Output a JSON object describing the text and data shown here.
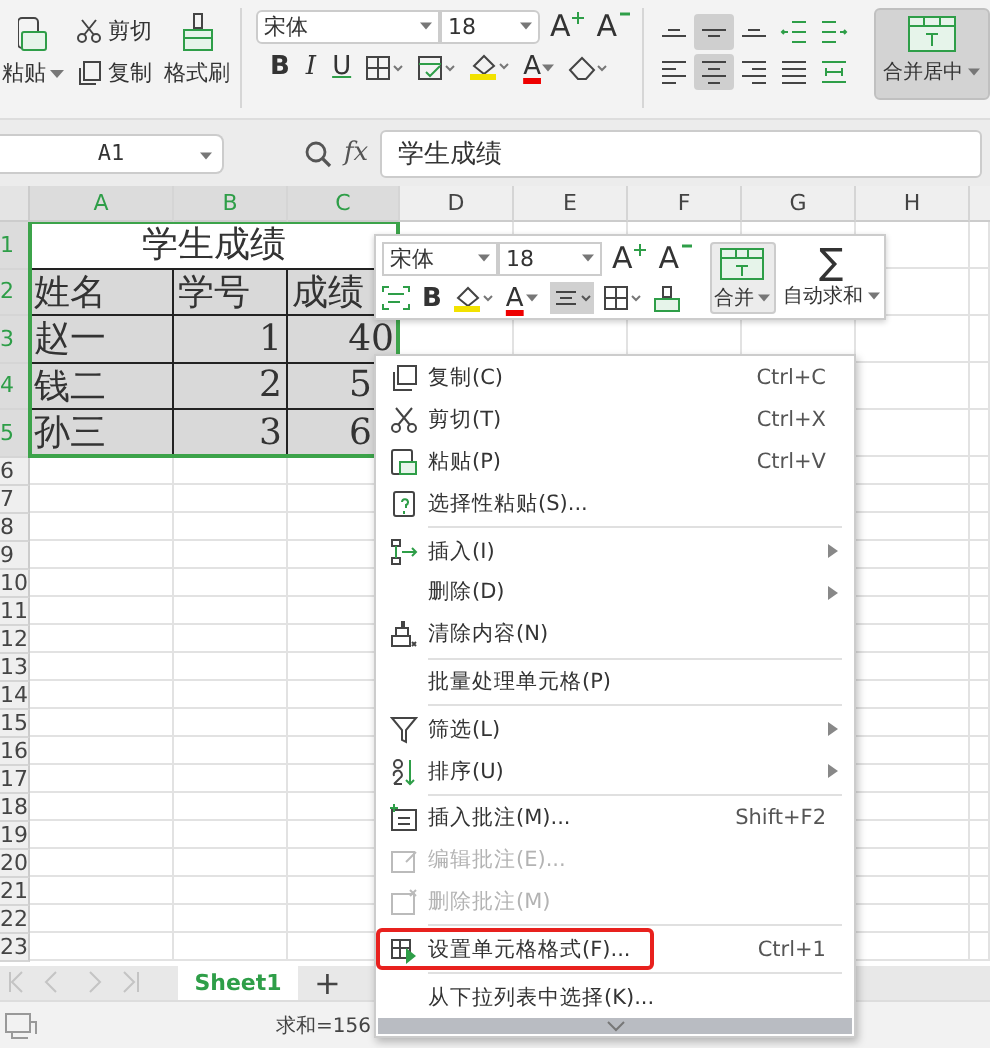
{
  "ribbon": {
    "paste": "粘贴",
    "cut": "剪切",
    "copy": "复制",
    "format_painter": "格式刷",
    "font_name": "宋体",
    "font_size": "18",
    "grow_font": "A",
    "shrink_font": "A",
    "bold": "B",
    "italic": "I",
    "underline": "U",
    "font_color": "A",
    "align_buttons": [
      {
        "selected": false
      },
      {
        "selected": true
      },
      {
        "selected": false
      },
      {
        "selected": false
      },
      {
        "selected": false
      },
      {
        "selected": false
      },
      {
        "selected": true
      },
      {
        "selected": false
      },
      {
        "selected": false
      },
      {
        "selected": false
      }
    ],
    "merge": {
      "label": "合并居中",
      "on": true
    }
  },
  "formula_bar": {
    "name_box": "A1",
    "fx": "fx",
    "value": "学生成绩"
  },
  "sheet": {
    "columns": [
      {
        "label": "A",
        "selected": true
      },
      {
        "label": "B",
        "selected": true
      },
      {
        "label": "C",
        "selected": true
      },
      {
        "label": "D",
        "selected": false
      },
      {
        "label": "E",
        "selected": false
      },
      {
        "label": "F",
        "selected": false
      },
      {
        "label": "G",
        "selected": false
      },
      {
        "label": "H",
        "selected": false
      }
    ],
    "rows": [
      {
        "label": "1",
        "selected": true
      },
      {
        "label": "2",
        "selected": true
      },
      {
        "label": "3",
        "selected": true
      },
      {
        "label": "4",
        "selected": true
      },
      {
        "label": "5",
        "selected": true
      },
      {
        "label": "6",
        "selected": false
      },
      {
        "label": "7",
        "selected": false
      },
      {
        "label": "8",
        "selected": false
      },
      {
        "label": "9",
        "selected": false
      },
      {
        "label": "10",
        "selected": false
      },
      {
        "label": "11",
        "selected": false
      },
      {
        "label": "12",
        "selected": false
      },
      {
        "label": "13",
        "selected": false
      },
      {
        "label": "14",
        "selected": false
      },
      {
        "label": "15",
        "selected": false
      },
      {
        "label": "16",
        "selected": false
      },
      {
        "label": "17",
        "selected": false
      },
      {
        "label": "18",
        "selected": false
      },
      {
        "label": "19",
        "selected": false
      },
      {
        "label": "20",
        "selected": false
      },
      {
        "label": "21",
        "selected": false
      },
      {
        "label": "22",
        "selected": false
      },
      {
        "label": "23",
        "selected": false
      }
    ],
    "title": {
      "text": "学生成绩",
      "selected": false
    },
    "data": [
      [
        {
          "text": "姓名",
          "kind": "text",
          "selected": true
        },
        {
          "text": "学号",
          "kind": "text",
          "selected": true
        },
        {
          "text": "成绩",
          "kind": "text",
          "selected": true
        }
      ],
      [
        {
          "text": "赵一",
          "kind": "text",
          "selected": true
        },
        {
          "text": "1",
          "kind": "number",
          "selected": true
        },
        {
          "text": "40",
          "kind": "number",
          "selected": true
        }
      ],
      [
        {
          "text": "钱二",
          "kind": "text",
          "selected": true
        },
        {
          "text": "2",
          "kind": "number",
          "selected": true
        },
        {
          "text": "5",
          "kind": "number_cut",
          "selected": true
        }
      ],
      [
        {
          "text": "孙三",
          "kind": "text",
          "selected": true
        },
        {
          "text": "3",
          "kind": "number",
          "selected": true
        },
        {
          "text": "6",
          "kind": "number_cut",
          "selected": true
        }
      ]
    ]
  },
  "mini_toolbar": {
    "font_name": "宋体",
    "font_size": "18",
    "grow_font": "A",
    "shrink_font": "A",
    "bold": "B",
    "font_color": "A",
    "merge": "合并",
    "autosum_symbol": "∑",
    "autosum": "自动求和"
  },
  "context_menu": {
    "items": [
      {
        "label": "复制(C)",
        "shortcut": "Ctrl+C",
        "submenu": false,
        "disabled": false,
        "highlighted": false,
        "separator_before": false
      },
      {
        "label": "剪切(T)",
        "shortcut": "Ctrl+X",
        "submenu": false,
        "disabled": false,
        "highlighted": false,
        "separator_before": false
      },
      {
        "label": "粘贴(P)",
        "shortcut": "Ctrl+V",
        "submenu": false,
        "disabled": false,
        "highlighted": false,
        "separator_before": false
      },
      {
        "label": "选择性粘贴(S)...",
        "submenu": false,
        "disabled": false,
        "highlighted": false,
        "separator_before": false
      },
      {
        "label": "插入(I)",
        "submenu": true,
        "disabled": false,
        "highlighted": false,
        "separator_before": true
      },
      {
        "label": "删除(D)",
        "submenu": true,
        "disabled": false,
        "highlighted": false,
        "separator_before": false
      },
      {
        "label": "清除内容(N)",
        "submenu": false,
        "disabled": false,
        "highlighted": false,
        "separator_before": false
      },
      {
        "label": "批量处理单元格(P)",
        "submenu": false,
        "disabled": false,
        "highlighted": false,
        "separator_before": true
      },
      {
        "label": "筛选(L)",
        "submenu": true,
        "disabled": false,
        "highlighted": false,
        "separator_before": true
      },
      {
        "label": "排序(U)",
        "submenu": true,
        "disabled": false,
        "highlighted": false,
        "separator_before": false
      },
      {
        "label": "插入批注(M)...",
        "shortcut": "Shift+F2",
        "submenu": false,
        "disabled": false,
        "highlighted": false,
        "separator_before": true
      },
      {
        "label": "编辑批注(E)...",
        "submenu": false,
        "disabled": true,
        "highlighted": false,
        "separator_before": false
      },
      {
        "label": "删除批注(M)",
        "submenu": false,
        "disabled": true,
        "highlighted": false,
        "separator_before": false
      },
      {
        "label": "设置单元格格式(F)...",
        "shortcut": "Ctrl+1",
        "submenu": false,
        "disabled": false,
        "highlighted": true,
        "separator_before": true
      },
      {
        "label": "从下拉列表中选择(K)...",
        "submenu": false,
        "disabled": false,
        "highlighted": false,
        "separator_before": true
      }
    ]
  },
  "sheet_tabs": [
    {
      "label": "Sheet1",
      "selected": true
    }
  ],
  "add_sheet": "+",
  "status_bar": {
    "sum": "求和=156"
  }
}
